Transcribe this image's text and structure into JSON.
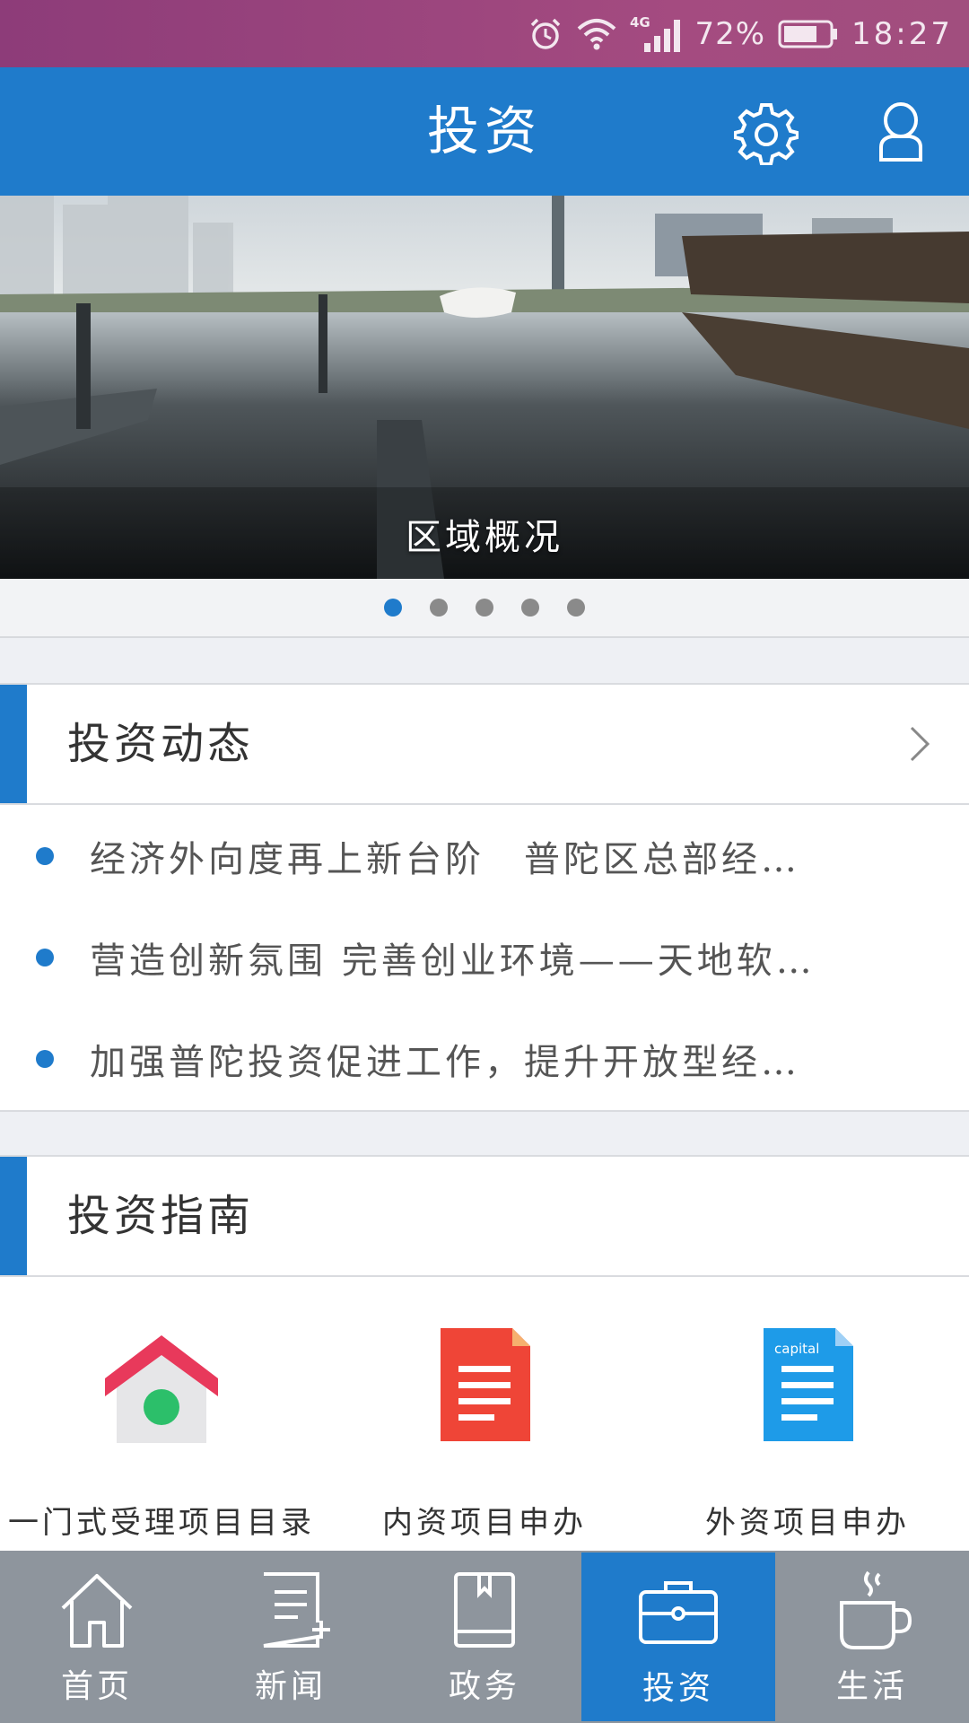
{
  "status_bar": {
    "icons": [
      "alarm-icon",
      "wifi-icon",
      "signal-4g-icon",
      "battery-icon"
    ],
    "network": "4G",
    "battery_percent": "72%",
    "time": "18:27"
  },
  "header": {
    "title": "投资",
    "icons": [
      "gear-icon",
      "user-icon"
    ]
  },
  "banner": {
    "caption": "区域概况",
    "slide_count": 5,
    "active_slide": 1
  },
  "investment_news": {
    "title": "投资动态",
    "items": [
      "经济外向度再上新台阶　普陀区总部经…",
      "营造创新氛围 完善创业环境——天地软…",
      "加强普陀投资促进工作，提升开放型经…"
    ]
  },
  "investment_guide": {
    "title": "投资指南",
    "items": [
      {
        "label": "一门式受理项目目录",
        "icon": "house-icon"
      },
      {
        "label": "内资项目申办",
        "icon": "red-document-icon"
      },
      {
        "label": "外资项目申办",
        "icon": "blue-document-icon",
        "icon_text": "capital"
      }
    ]
  },
  "bottom_nav": {
    "items": [
      {
        "label": "首页",
        "icon": "home-icon"
      },
      {
        "label": "新闻",
        "icon": "news-icon"
      },
      {
        "label": "政务",
        "icon": "book-icon"
      },
      {
        "label": "投资",
        "icon": "briefcase-icon"
      },
      {
        "label": "生活",
        "icon": "coffee-cup-icon"
      }
    ],
    "active_index": 3
  },
  "colors": {
    "status_bar": "#9c4680",
    "primary": "#1f7bcb",
    "nav_background": "#8e959d",
    "page_background": "#eef0f4",
    "house_roof": "#e8395b",
    "house_door": "#2cbf6a",
    "red_doc": "#ef4537",
    "blue_doc": "#1e9be8"
  }
}
